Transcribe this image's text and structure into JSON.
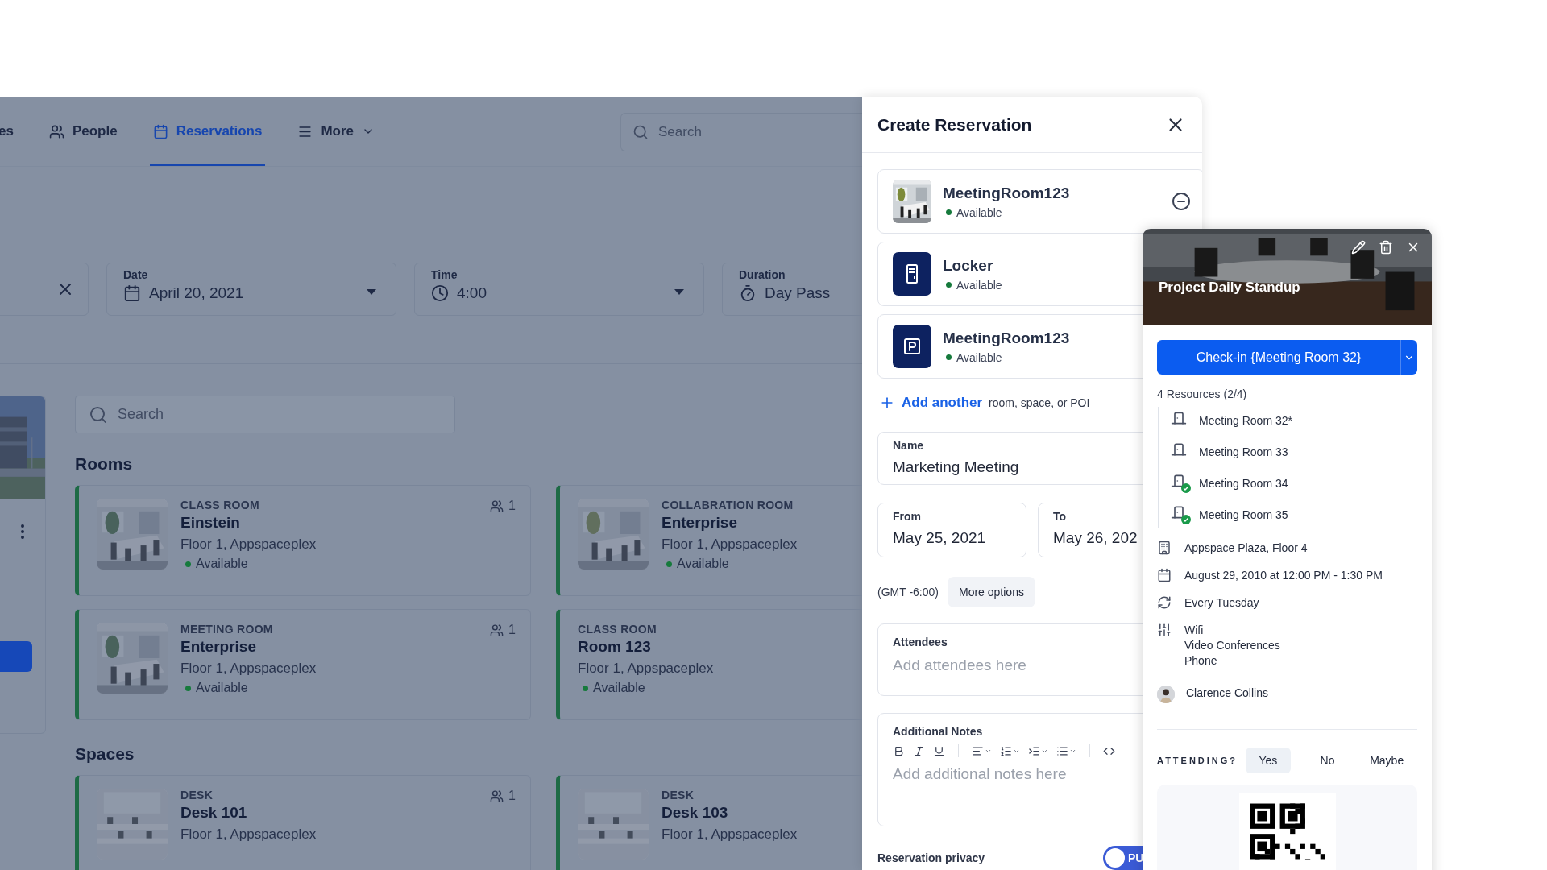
{
  "nav": {
    "tabs": [
      {
        "label": "es",
        "selected": false,
        "dropdown": false
      },
      {
        "label": "People",
        "selected": false,
        "dropdown": false
      },
      {
        "label": "Reservations",
        "selected": true,
        "dropdown": false
      },
      {
        "label": "More",
        "selected": false,
        "dropdown": true
      }
    ],
    "search": {
      "placeholder": "Search"
    }
  },
  "filters": [
    {
      "kind": "clear"
    },
    {
      "kind": "select",
      "label": "Date",
      "value": "April 20, 2021",
      "dropdown": true
    },
    {
      "kind": "select",
      "label": "Time",
      "value": "4:00",
      "dropdown": true
    },
    {
      "kind": "select",
      "label": "Duration",
      "value": "Day Pass"
    }
  ],
  "content": {
    "search": {
      "placeholder": "Search"
    },
    "sections": [
      {
        "title": "Rooms",
        "cards": [
          {
            "category": "CLASS ROOM",
            "name": "Einstein",
            "location": "Floor 1, Appspaceplex",
            "status": "Available",
            "capacity": "1"
          },
          {
            "category": "COLLABRATION ROOM",
            "name": "Enterprise",
            "location": "Floor 1, Appspaceplex",
            "status": "Available"
          },
          {
            "category": "MEETING ROOM",
            "name": "Enterprise",
            "location": "Floor 1, Appspaceplex",
            "status": "Available",
            "capacity": "1"
          },
          {
            "category": "CLASS ROOM",
            "name": "Room 123",
            "location": "Floor 1, Appspaceplex",
            "status": "Available"
          }
        ]
      },
      {
        "title": "Spaces",
        "cards": [
          {
            "category": "DESK",
            "name": "Desk 101",
            "location": "Floor 1, Appspaceplex",
            "capacity": "1"
          },
          {
            "category": "DESK",
            "name": "Desk 103",
            "location": "Floor 1, Appspaceplex"
          }
        ]
      }
    ]
  },
  "drawer": {
    "title": "Create Reservation",
    "resources": [
      {
        "name": "MeetingRoom123",
        "status": "Available",
        "removable": true
      },
      {
        "name": "Locker",
        "status": "Available",
        "kind": "locker"
      },
      {
        "name": "MeetingRoom123",
        "status": "Available",
        "kind": "parking"
      }
    ],
    "add_link": "Add another",
    "add_hint": "room, space, or POI",
    "name_field": {
      "label": "Name",
      "value": "Marketing Meeting"
    },
    "from": {
      "label": "From",
      "value": "May 25, 2021"
    },
    "to": {
      "label": "To",
      "value": "May 26, 202"
    },
    "timezone": "(GMT -6:00)",
    "more_options": "More options",
    "attendees": {
      "label": "Attendees",
      "placeholder": "Add attendees here"
    },
    "notes": {
      "label": "Additional Notes",
      "placeholder": "Add additional notes here"
    },
    "privacy": {
      "label": "Reservation privacy",
      "toggle_text": "PU"
    }
  },
  "event": {
    "title": "Project Daily Standup",
    "checkin": "Check-in {Meeting Room 32}",
    "resources_heading": "4 Resources (2/4)",
    "resources": [
      {
        "name": "Meeting Room 32*",
        "checked_in": false
      },
      {
        "name": "Meeting Room 33",
        "checked_in": false
      },
      {
        "name": "Meeting Room 34",
        "checked_in": true
      },
      {
        "name": "Meeting Room 35",
        "checked_in": true
      }
    ],
    "details": [
      {
        "kind": "building",
        "lines": [
          "Appspace Plaza, Floor 4"
        ]
      },
      {
        "kind": "calendar",
        "lines": [
          "August 29, 2010 at 12:00 PM - 1:30 PM"
        ]
      },
      {
        "kind": "repeat",
        "lines": [
          "Every Tuesday"
        ]
      },
      {
        "kind": "amenities",
        "lines": [
          "Wifi",
          "Video Conferences",
          "Phone"
        ]
      },
      {
        "kind": "person",
        "lines": [
          "Clarence Collins"
        ]
      }
    ],
    "attending": {
      "label": "ATTENDING?",
      "options": [
        {
          "label": "Yes",
          "selected": true
        },
        {
          "label": "No",
          "selected": false
        },
        {
          "label": "Maybe",
          "selected": false
        }
      ]
    }
  }
}
